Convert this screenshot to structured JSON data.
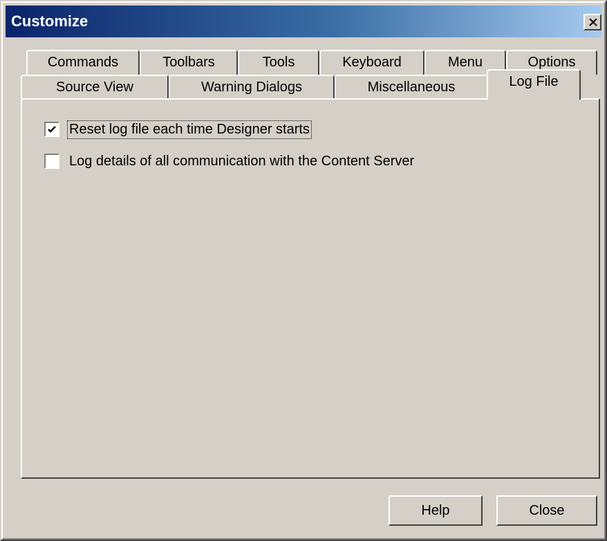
{
  "window": {
    "title": "Customize"
  },
  "tabs_back_row": [
    {
      "label": "Commands"
    },
    {
      "label": "Toolbars"
    },
    {
      "label": "Tools"
    },
    {
      "label": "Keyboard"
    },
    {
      "label": "Menu"
    },
    {
      "label": "Options"
    }
  ],
  "tabs_front_row": [
    {
      "label": "Source View"
    },
    {
      "label": "Warning Dialogs"
    },
    {
      "label": "Miscellaneous"
    },
    {
      "label": "Log File"
    }
  ],
  "active_tab": "Log File",
  "options": [
    {
      "label": "Reset log file each time Designer starts",
      "checked": true
    },
    {
      "label": "Log details of all communication with the Content Server",
      "checked": false
    }
  ],
  "buttons": {
    "help": "Help",
    "close": "Close"
  }
}
